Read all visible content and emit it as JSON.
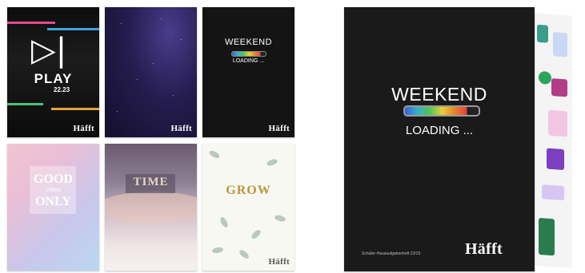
{
  "covers": {
    "play": {
      "title": "PLAY",
      "year": "22.23"
    },
    "weekend": {
      "title": "WEEKEND",
      "loading": "LOADING ..."
    },
    "good": {
      "line1": "GOOD",
      "line2": "vibes",
      "line3": "ONLY"
    },
    "time": {
      "title": "TIME"
    },
    "grow": {
      "title": "GROW"
    }
  },
  "brand": "Häfft",
  "featured": {
    "title": "WEEKEND",
    "loading": "LOADING ...",
    "subtitle": "Schüler-Hausaufgabenheft 22/23"
  }
}
